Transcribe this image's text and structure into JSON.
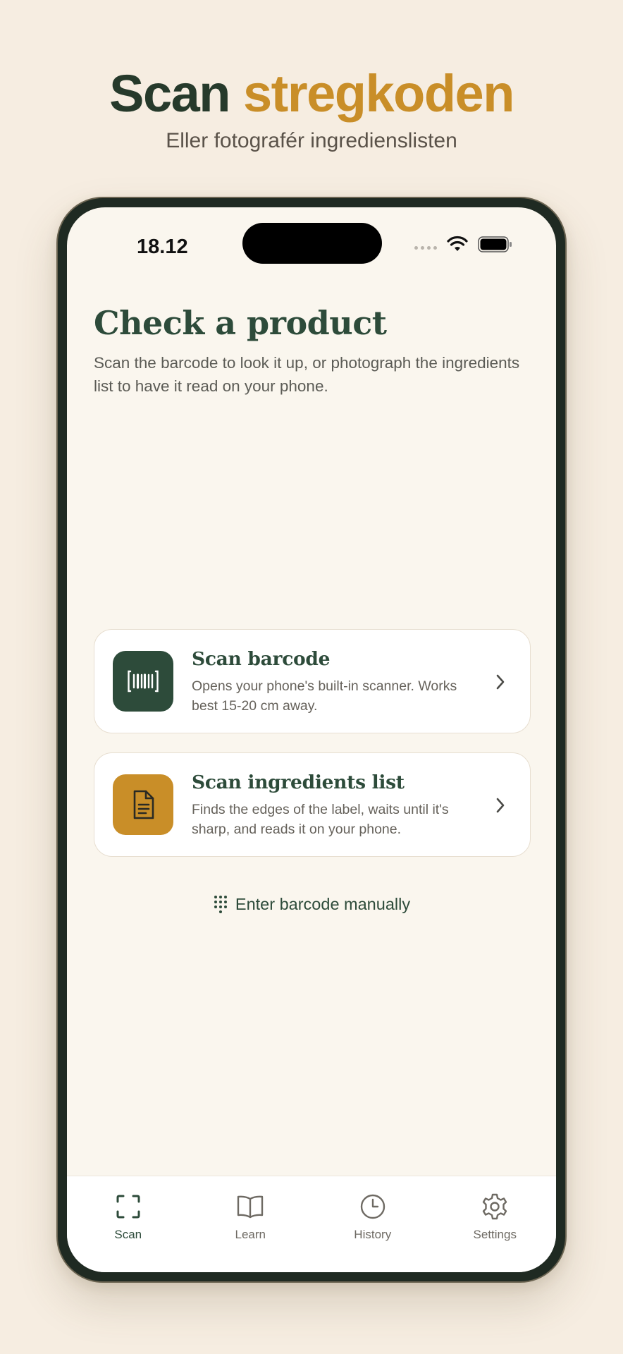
{
  "hero": {
    "title_part1": "Scan",
    "title_part2": "stregkoden",
    "subtitle": "Eller fotografér ingredienslisten"
  },
  "status_bar": {
    "time": "18.12"
  },
  "page": {
    "title": "Check a product",
    "description": "Scan the barcode to look it up, or photograph the ingredients list to have it read on your phone."
  },
  "cards": [
    {
      "title": "Scan barcode",
      "description": "Opens your phone's built-in scanner. Works best 15-20 cm away.",
      "icon": "barcode-icon"
    },
    {
      "title": "Scan ingredients list",
      "description": "Finds the edges of the label, waits until it's sharp, and reads it on your phone.",
      "icon": "document-icon"
    }
  ],
  "manual_entry": {
    "label": "Enter barcode manually",
    "icon": "keypad-icon"
  },
  "tabs": [
    {
      "label": "Scan",
      "icon": "scan-icon",
      "active": true
    },
    {
      "label": "Learn",
      "icon": "book-icon",
      "active": false
    },
    {
      "label": "History",
      "icon": "clock-icon",
      "active": false
    },
    {
      "label": "Settings",
      "icon": "gear-icon",
      "active": false
    }
  ],
  "colors": {
    "background": "#f6ede1",
    "primary_green": "#2d4b3a",
    "accent_gold": "#c98e28",
    "screen": "#faf6ee"
  }
}
